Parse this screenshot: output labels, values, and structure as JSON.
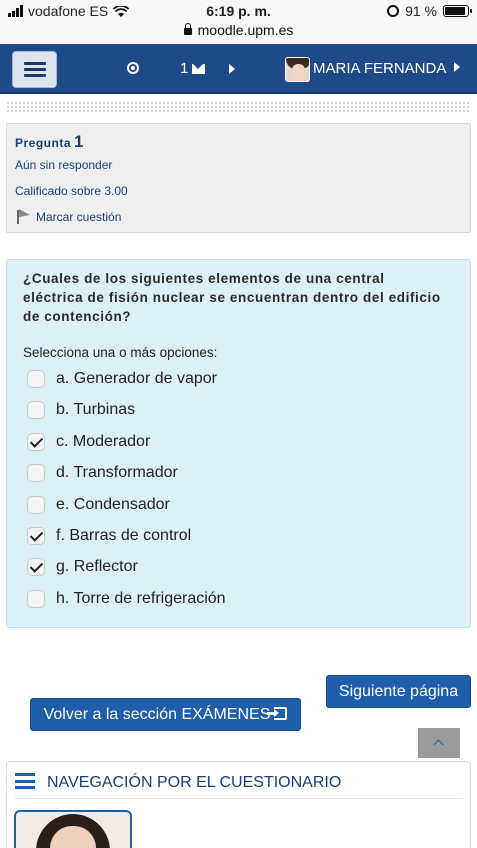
{
  "status_bar": {
    "carrier": "vodafone ES",
    "time": "6:19 p. m.",
    "battery_percent": "91 %",
    "battery_level": 0.91
  },
  "url_bar": {
    "host": "moodle.upm.es"
  },
  "navbar": {
    "message_count": "1",
    "user_name": "MARIA FERNANDA"
  },
  "question_info": {
    "label": "Pregunta",
    "number": "1",
    "status": "Aún sin responder",
    "grade": "Calificado sobre 3.00",
    "flag_label": "Marcar cuestión"
  },
  "question": {
    "text": "¿Cuales de los siguientes elementos de una central eléctrica de fisión nuclear se encuentran dentro del edificio de contención?",
    "prompt": "Selecciona una o más opciones:",
    "options": [
      {
        "label": "a. Generador de vapor",
        "checked": false
      },
      {
        "label": "b. Turbinas",
        "checked": false
      },
      {
        "label": "c. Moderador",
        "checked": true
      },
      {
        "label": "d. Transformador",
        "checked": false
      },
      {
        "label": "e. Condensador",
        "checked": false
      },
      {
        "label": "f. Barras de control",
        "checked": true
      },
      {
        "label": "g. Reflector",
        "checked": true
      },
      {
        "label": "h. Torre de refrigeración",
        "checked": false
      }
    ]
  },
  "buttons": {
    "next": "Siguiente página",
    "back": "Volver a la sección EXÁMENES"
  },
  "quiz_nav": {
    "title": "NAVEGACIÓN POR EL CUESTIONARIO"
  },
  "colors": {
    "navbar": "#1e4a8a",
    "button": "#1f5ea8",
    "question_bg": "#def0f7",
    "info_bg": "#efefef"
  }
}
